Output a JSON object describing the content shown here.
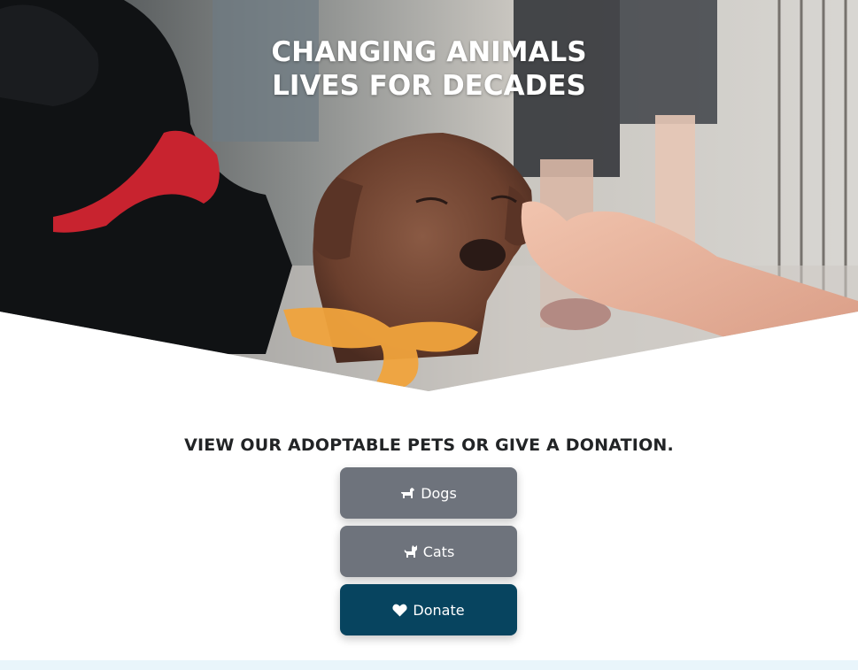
{
  "hero": {
    "title_line1": "CHANGING ANIMALS",
    "title_line2": "LIVES FOR DECADES",
    "image": "puppy-being-petted-photo"
  },
  "cta": {
    "heading": "VIEW OUR ADOPTABLE PETS OR GIVE A DONATION.",
    "buttons": [
      {
        "label": "Dogs",
        "icon": "dog-icon",
        "color": "#6e737c"
      },
      {
        "label": "Cats",
        "icon": "cat-icon",
        "color": "#6e737c"
      },
      {
        "label": "Donate",
        "icon": "heart-icon",
        "color": "#07445f"
      }
    ]
  }
}
